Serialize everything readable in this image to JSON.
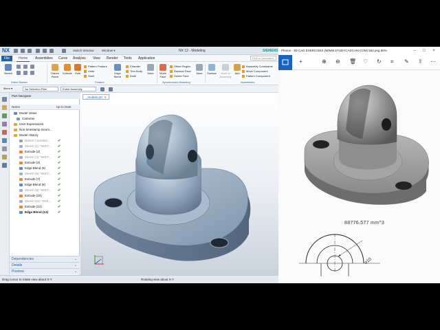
{
  "nx": {
    "app_logo": "NX",
    "switch_window": "Switch Window",
    "window_menu": "Window ▾",
    "title": "NX 12 - Modeling",
    "brand": "SIEMENS",
    "menu_tabs": [
      "File",
      "Home",
      "Assemblies",
      "Curve",
      "Analysis",
      "View",
      "Render",
      "Tools",
      "Application"
    ],
    "search_placeholder": "Find a Command",
    "ribbon": {
      "sketch": "Sketch",
      "datum_plane": "Datum Plane",
      "extrude": "Extrude",
      "hole": "Hole",
      "pattern_feature": "Pattern Feature",
      "unite": "Unite",
      "shell": "Shell",
      "edge_blend": "Edge Blend",
      "chamfer": "Chamfer",
      "trim_body": "Trim Body",
      "draft": "Draft",
      "more1": "More",
      "offset_region": "Offset Region",
      "replace_face": "Replace Face",
      "delete_face": "Delete Face",
      "move_face": "Move Face",
      "more2": "More",
      "surface": "Surface",
      "work_section": "Work in Assembly",
      "add": "Add",
      "assembly_constraints": "Assembly Constraints",
      "move_component": "Move Component",
      "pattern_component": "Pattern Component",
      "groups": {
        "direct_sketch": "Direct Sketch",
        "feature": "Feature",
        "sync": "Synchronous Modeling",
        "assemblies": "Assemblies"
      }
    },
    "cmdbar": {
      "menu": "Menu ▾",
      "filter": "No Selection Filter",
      "scope": "Entire Assembly"
    },
    "navigator": {
      "title": "Part Navigator",
      "col_name": "Name",
      "col_uptodate": "Up to Date",
      "rows": [
        {
          "label": "Model Views",
          "checked": false
        },
        {
          "label": "Cameras",
          "checked": false
        },
        {
          "label": "User Expressions",
          "checked": false
        },
        {
          "label": "Non-timestamp Geom...",
          "checked": false
        },
        {
          "label": "Model History",
          "checked": false
        },
        {
          "label": "Datum Coordina...",
          "checked": true
        },
        {
          "label": "Sketch (1) \"SKET...",
          "checked": true
        },
        {
          "label": "Extrude (2)",
          "checked": true
        },
        {
          "label": "Sketch (3) \"SKET...",
          "checked": true
        },
        {
          "label": "Extrude (4)",
          "checked": true
        },
        {
          "label": "Edge Blend (5)",
          "checked": true
        },
        {
          "label": "Sketch (6) \"SKET...",
          "checked": true
        },
        {
          "label": "Extrude (7)",
          "checked": true
        },
        {
          "label": "Edge Blend (8)",
          "checked": true
        },
        {
          "label": "Sketch (9) \"SKET...",
          "checked": true
        },
        {
          "label": "Extrude (10)",
          "checked": true
        },
        {
          "label": "Sketch (11) \"SKE...",
          "checked": true
        },
        {
          "label": "Extrude (12)",
          "checked": true
        },
        {
          "label": "Edge Blend (13)",
          "checked": true
        }
      ],
      "check_glyph": "✔",
      "panels": [
        "Dependencies",
        "Details",
        "Preview"
      ]
    },
    "viewport_tab": "_model1.prt",
    "viewport_tab_close": "×",
    "status_left": "Drag cursor to rotate view about X-Y",
    "status_right": "Rotating view about X-Y"
  },
  "photos": {
    "title": "Photos - 3D CAD EXERCISES (WWW.STUDYCADCAM.COM) 552.png  80%",
    "volume": "88776.577 mm^3",
    "dimension": "⌀10",
    "icons": [
      "add-icon",
      "zoom-in-icon",
      "zoom-out-icon",
      "delete-icon",
      "heart-icon",
      "rotate-icon",
      "crop-icon",
      "edit-icon",
      "share-icon",
      "more-icon"
    ]
  }
}
